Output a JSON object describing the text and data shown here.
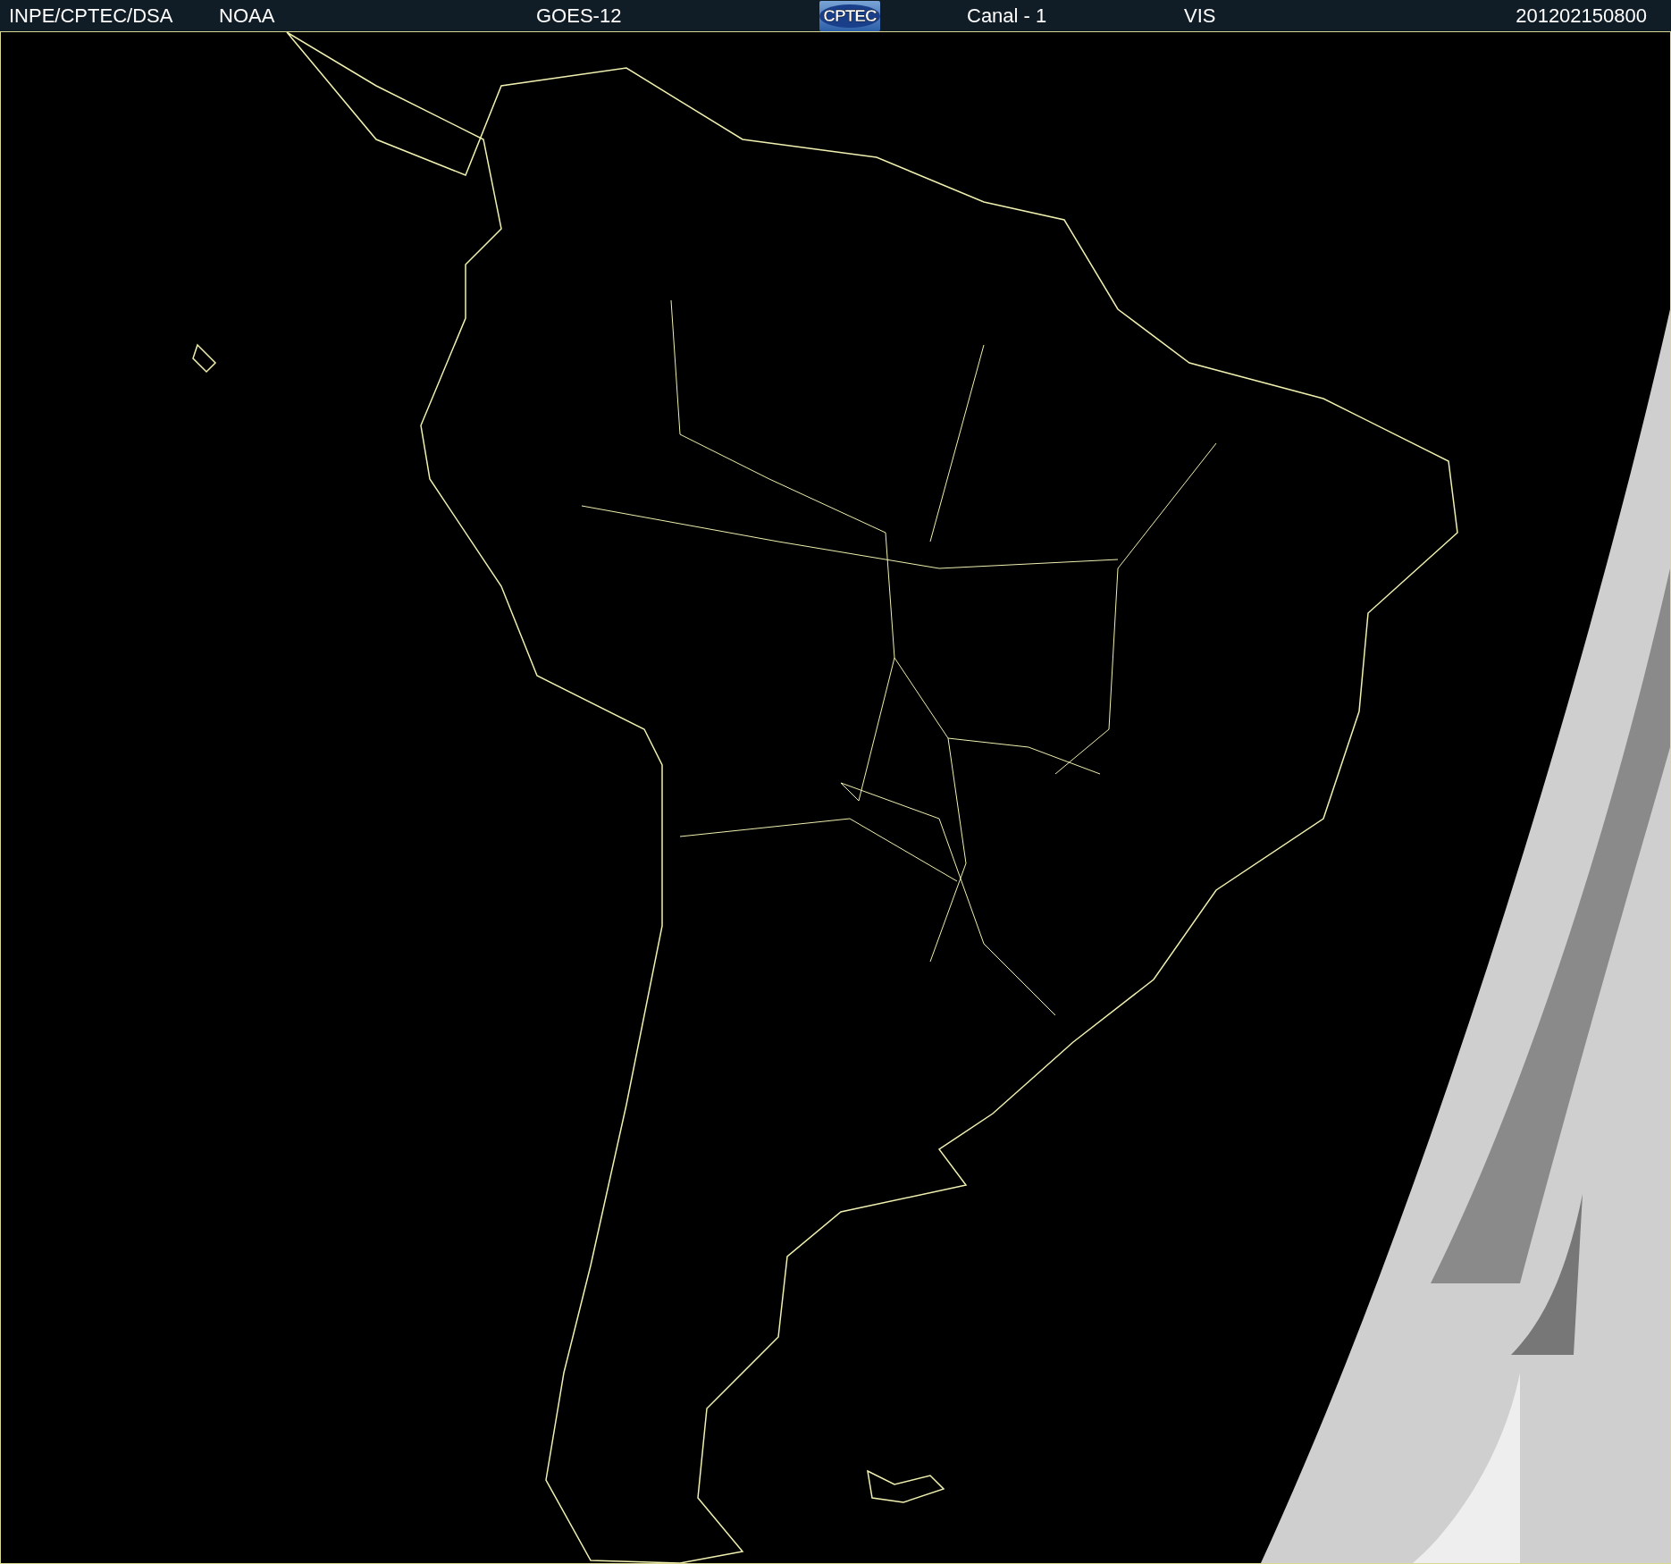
{
  "header": {
    "source": "INPE/CPTEC/DSA",
    "agency": "NOAA",
    "satellite": "GOES-12",
    "logo": "CPTEC",
    "channel": "Canal - 1",
    "band": "VIS",
    "timestamp": "201202150800"
  }
}
